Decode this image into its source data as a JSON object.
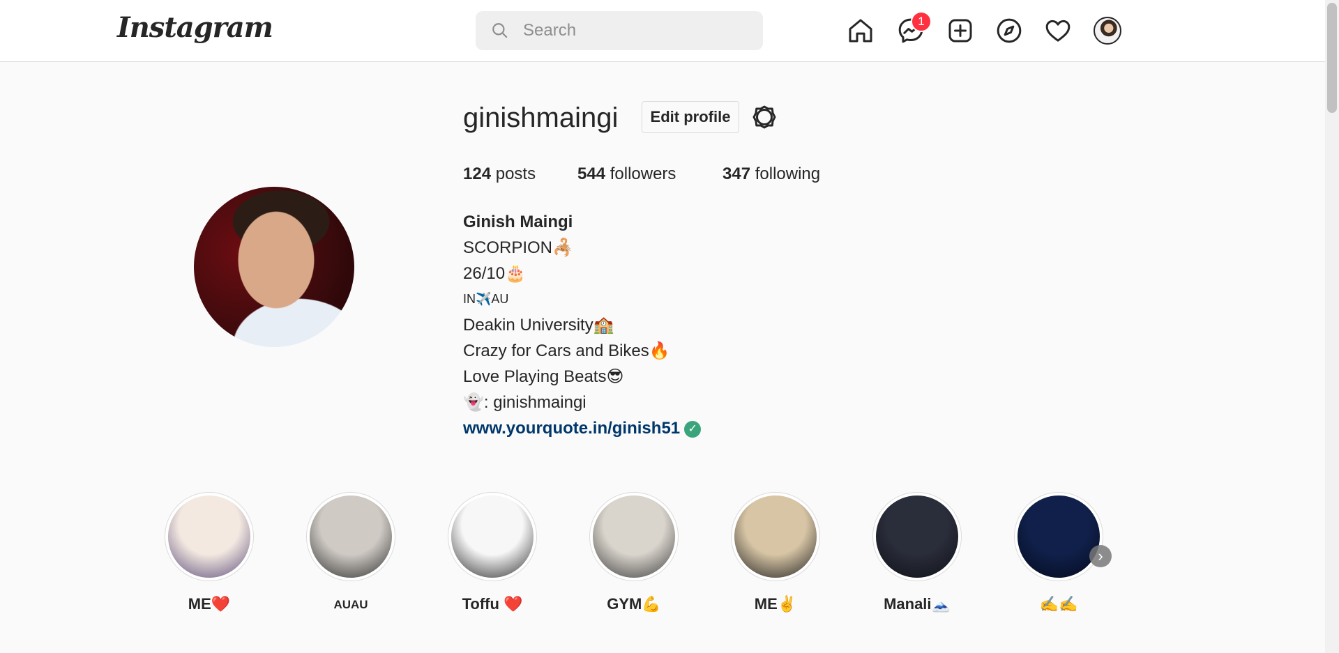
{
  "header": {
    "logo": "Instagram",
    "search_placeholder": "Search",
    "messages_badge": "1",
    "icons": [
      "home-icon",
      "messenger-icon",
      "new-post-icon",
      "explore-icon",
      "activity-heart-icon",
      "profile-avatar"
    ]
  },
  "profile": {
    "username": "ginishmaingi",
    "edit_button": "Edit profile",
    "stats": {
      "posts_count": "124",
      "posts_label": " posts",
      "followers_count": "544",
      "followers_label": " followers",
      "following_count": "347",
      "following_label": " following"
    },
    "bio": {
      "full_name": "Ginish Maingi",
      "lines": [
        "SCORPION🦂",
        "26/10🎂",
        "IN✈️AU",
        "Deakin University🏫",
        "Crazy for Cars and Bikes🔥",
        "Love Playing Beats😎",
        "👻: ginishmaingi"
      ],
      "website": "www.yourquote.in/ginish51",
      "verified_mark": "✓"
    }
  },
  "highlights": [
    {
      "label": "ME❤️",
      "colors": [
        "#f3e9e0",
        "#5a4a7a"
      ]
    },
    {
      "label": "AUAU",
      "colors": [
        "#cfcac4",
        "#2b2b2b"
      ]
    },
    {
      "label": "Toffu ❤️",
      "colors": [
        "#f7f7f7",
        "#2a2a2a"
      ]
    },
    {
      "label": "GYM💪",
      "colors": [
        "#d9d4cc",
        "#3b3b3b"
      ]
    },
    {
      "label": "ME✌️",
      "colors": [
        "#d7c5a5",
        "#1e1e1e"
      ]
    },
    {
      "label": "Manali🗻",
      "colors": [
        "#2a2d3a",
        "#0e0f16"
      ]
    },
    {
      "label": "✍️✍️",
      "colors": [
        "#10204a",
        "#050a1c"
      ]
    }
  ],
  "highlights_next": "›"
}
